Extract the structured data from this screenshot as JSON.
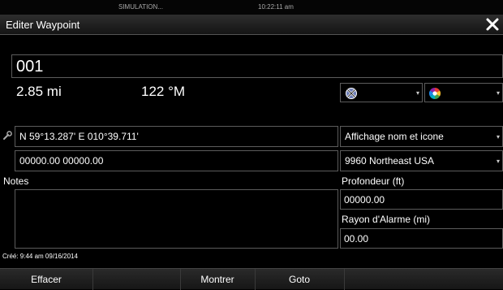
{
  "statusbar": {
    "mode": "SIMULATION...",
    "time": "10:22:11 am"
  },
  "window": {
    "title": "Editer Waypoint",
    "close_icon": "close-icon"
  },
  "waypoint": {
    "name": "001",
    "distance": "2.85 mi",
    "bearing": "122 °M",
    "symbol_icon": "waypoint-symbol-icon",
    "color_icon": "color-wheel-icon"
  },
  "position": {
    "icon": "wrench-icon",
    "lat_lon": "N 59°13.287'  E 010°39.711'",
    "loran": "00000.00 00000.00"
  },
  "display_option": "Affichage nom et icone",
  "loran_chain": "9960 Northeast USA",
  "depth": {
    "label": "Profondeur (ft)",
    "value": "00000.00"
  },
  "alarm_radius": {
    "label": "Rayon d'Alarme (mi)",
    "value": "00.00"
  },
  "notes": {
    "label": "Notes",
    "value": ""
  },
  "created": "Créé: 9:44 am 09/16/2014",
  "buttons": {
    "delete": "Effacer",
    "show": "Montrer",
    "goto": "Goto"
  },
  "colors": {
    "title_underline": "#545454",
    "field_border": "#5c5c5c",
    "background": "#000000"
  }
}
